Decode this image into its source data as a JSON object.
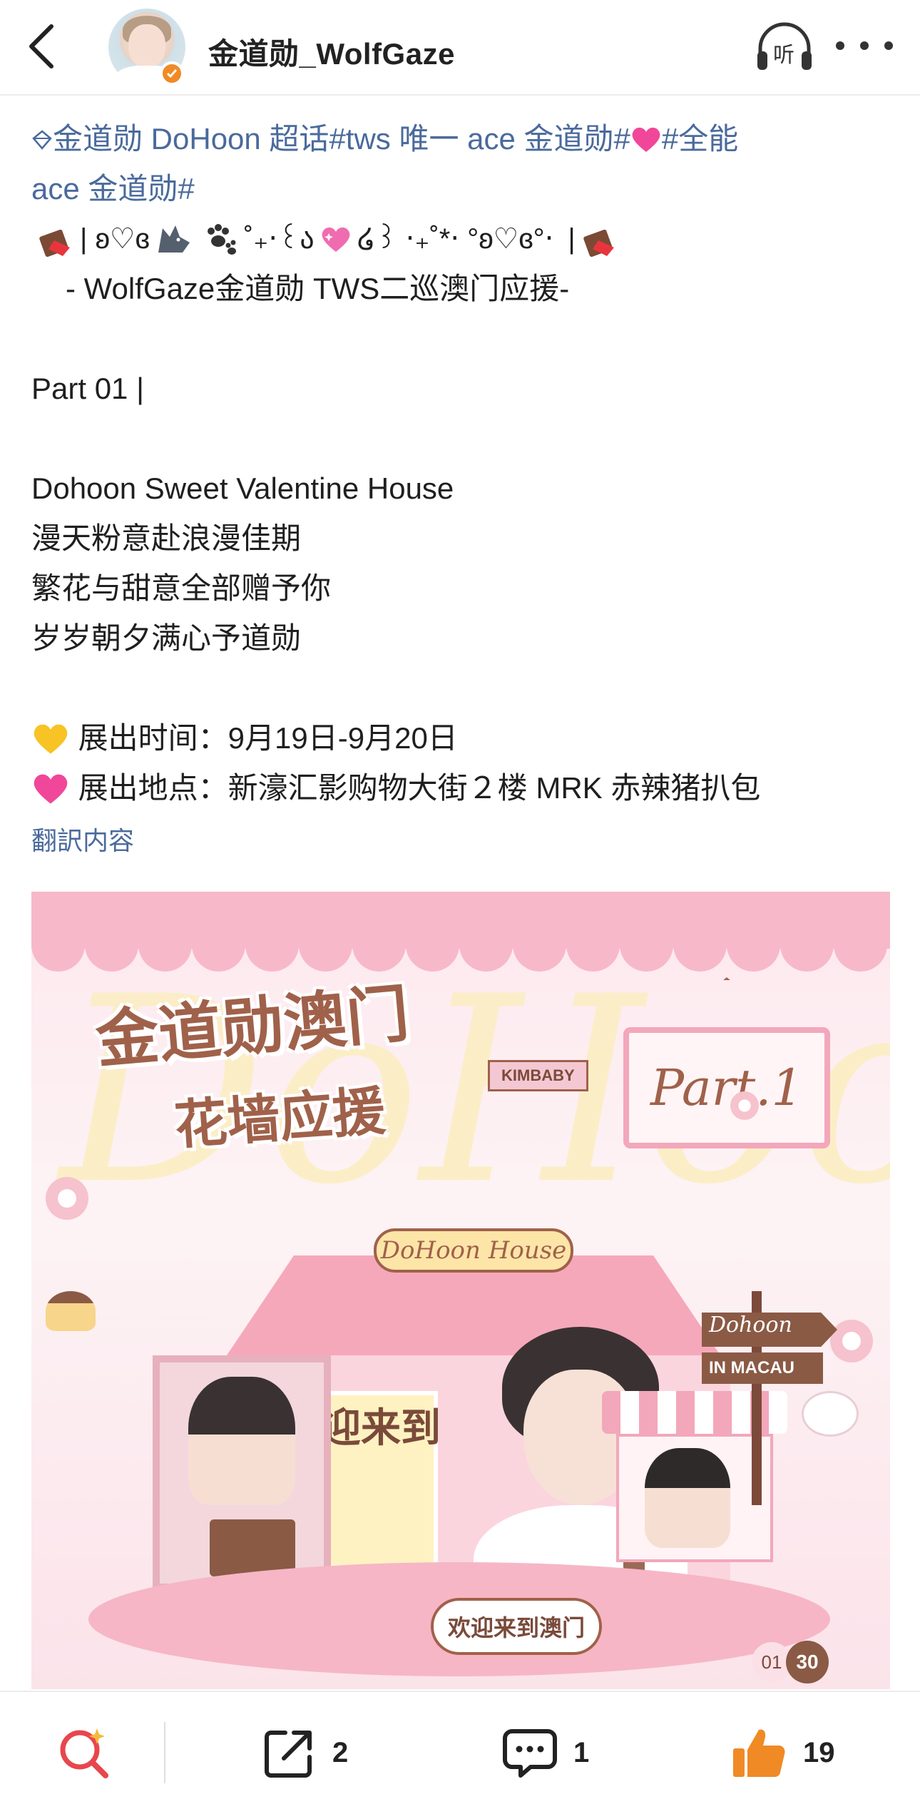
{
  "header": {
    "username": "金道勋_WolfGaze",
    "listen_label": "听"
  },
  "post": {
    "topic_line_1_prefix": "金道勋 DoHoon 超话",
    "topic_tag_1": "#tws 唯一 ace 金道勋#",
    "topic_tag_2_a": "#全能",
    "topic_tag_2_b": "ace 金道勋#",
    "deco_a": "| ʚ♡ɞ",
    "deco_b": "˚₊‧꒰ა",
    "deco_c": "໒꒱ ‧₊˚*‧ °ʚ♡ɞ°‧",
    "deco_d": "|",
    "subtitle": "- WolfGaze金道勋 TWS二巡澳门应援-",
    "part": "Part 01  |",
    "headline": "Dohoon Sweet Valentine House",
    "line_1": "漫天粉意赴浪漫佳期",
    "line_2": "繁花与甜意全部赠予你",
    "line_3": "岁岁朝夕满心予道勋",
    "time_line": "展出时间：9月19日-9月20日",
    "place_line": "展出地点：新濠汇影购物大街２楼 MRK 赤辣猪扒包",
    "translate_label": "翻訳内容"
  },
  "poster": {
    "title": "金道勋澳门",
    "subtitle": "花墙应援",
    "tag": "KIMBABY",
    "part_sign": "Part.1",
    "house_sign": "DoHoon House",
    "welcome_big": "欢迎来到\n门",
    "sign_1": "Dohoon",
    "sign_2": "IN MACAU",
    "welcome_badge": "欢迎来到澳门",
    "date_1": "01",
    "date_2": "30",
    "big_letter": "DoHoon"
  },
  "toolbar": {
    "share_count": "2",
    "comment_count": "1",
    "like_count": "19"
  },
  "colors": {
    "link": "#4a6a9c",
    "like": "#f08a24",
    "search_red": "#e8464c",
    "poster_brown": "#a0614a",
    "poster_pink": "#f6a8bb"
  }
}
